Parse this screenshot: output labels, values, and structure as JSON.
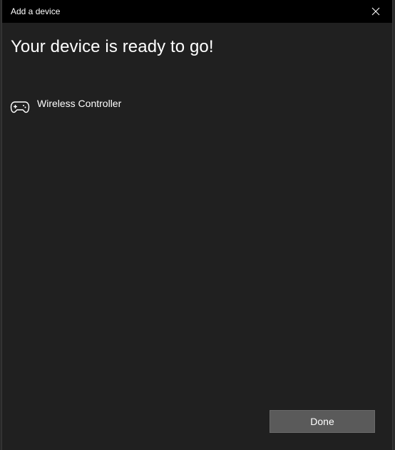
{
  "window": {
    "title": "Add a device"
  },
  "main": {
    "heading": "Your device is ready to go!",
    "device": {
      "icon": "gamepad-icon",
      "name": "Wireless Controller"
    }
  },
  "footer": {
    "done_label": "Done"
  },
  "colors": {
    "titlebar": "#000000",
    "background": "#202020",
    "button": "#5a5a5a",
    "text": "#ffffff"
  }
}
